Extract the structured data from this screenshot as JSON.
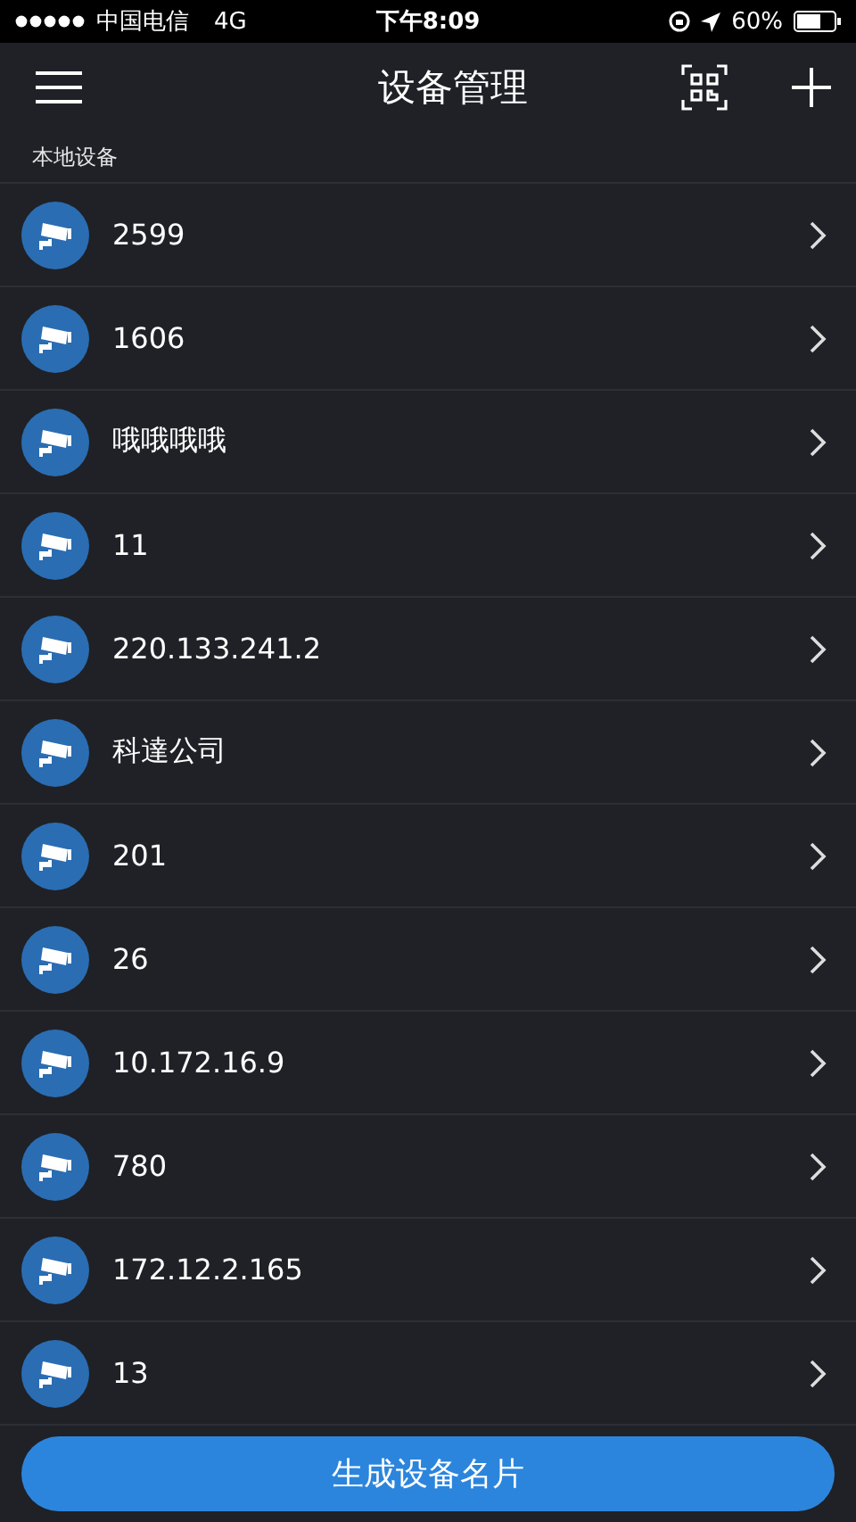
{
  "status_bar": {
    "carrier": "中国电信",
    "network": "4G",
    "time": "下午8:09",
    "battery": "60%"
  },
  "nav": {
    "title": "设备管理"
  },
  "section": {
    "title": "本地设备"
  },
  "devices": [
    {
      "name": "2599"
    },
    {
      "name": "1606"
    },
    {
      "name": "哦哦哦哦"
    },
    {
      "name": "11"
    },
    {
      "name": "220.133.241.2"
    },
    {
      "name": "科達公司"
    },
    {
      "name": "201"
    },
    {
      "name": "26"
    },
    {
      "name": "10.172.16.9"
    },
    {
      "name": "780"
    },
    {
      "name": "172.12.2.165"
    },
    {
      "name": "13"
    }
  ],
  "button": {
    "label": "生成设备名片"
  }
}
